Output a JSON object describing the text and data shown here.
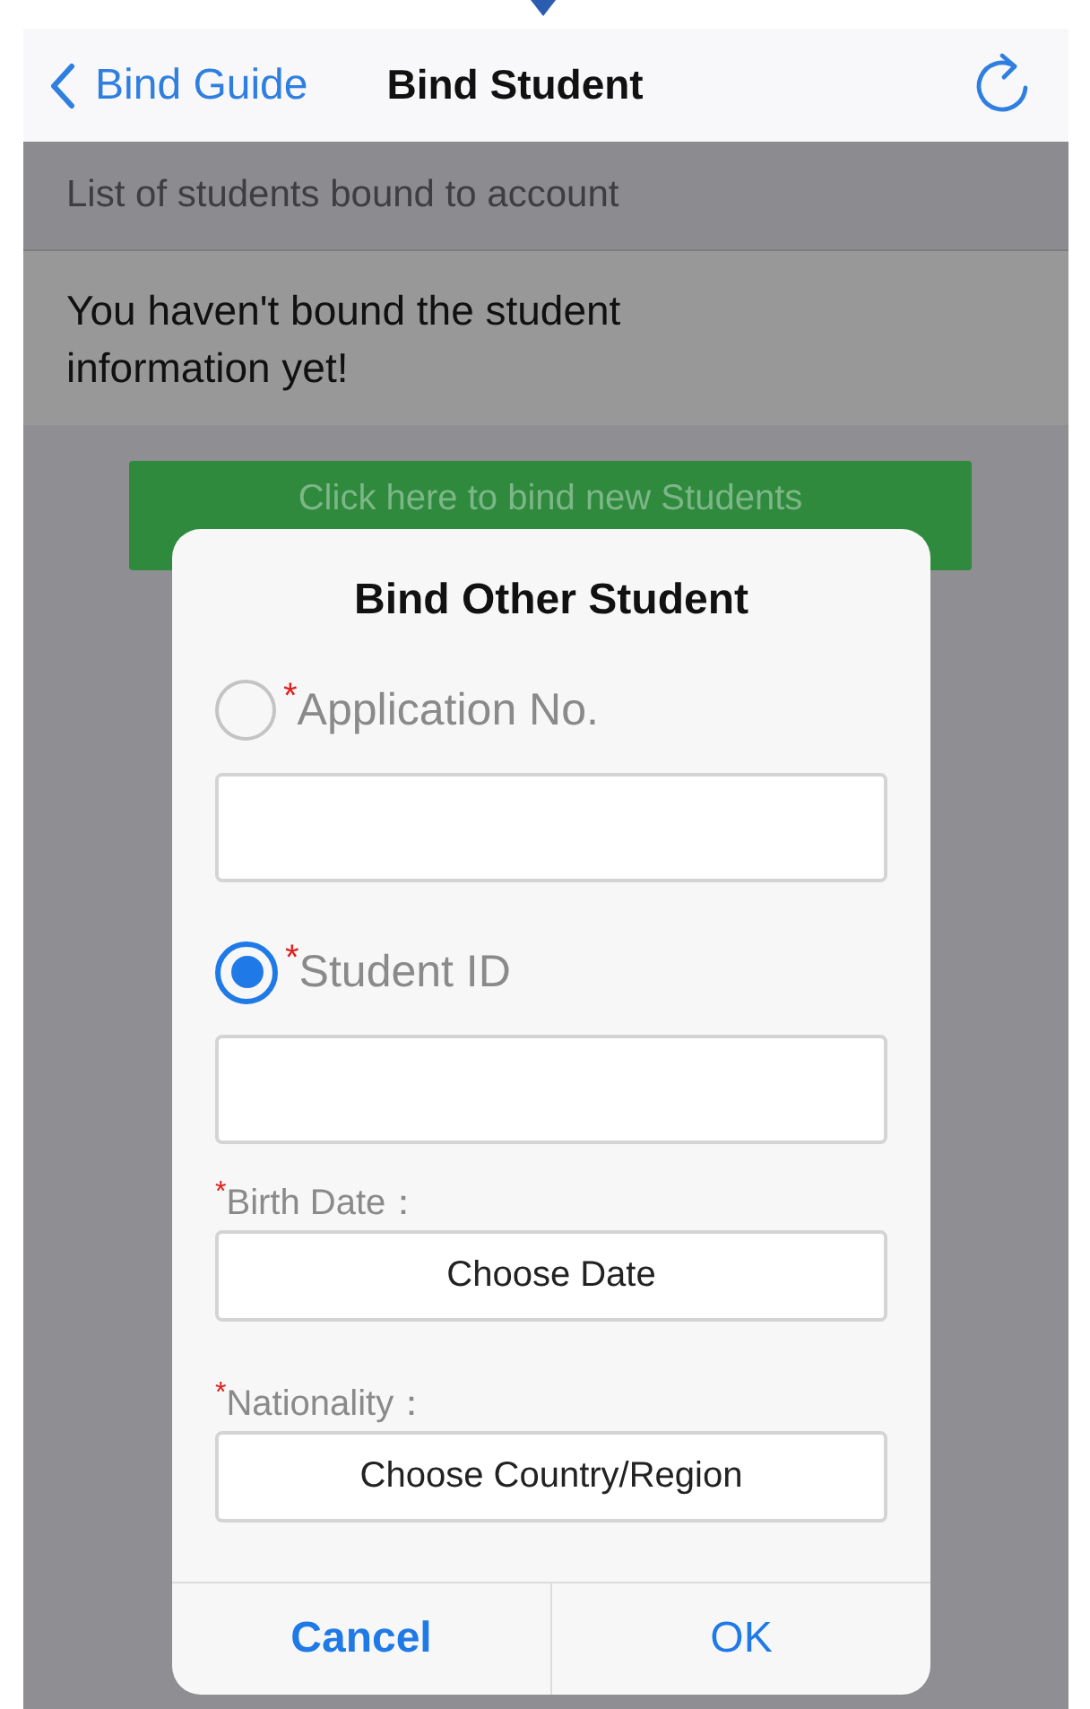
{
  "nav_bar": {
    "back_label": "Bind Guide",
    "title": "Bind Student"
  },
  "section_header": "List of students bound to account",
  "empty_message": "You haven't bound the student information yet!",
  "bind_button": "Click here to bind new Students",
  "dialog": {
    "title": "Bind Other Student",
    "options": [
      {
        "label": "$^{*}$Application No.",
        "selected": false
      },
      {
        "label": "$^{*}$Student ID",
        "selected": true
      }
    ],
    "pickers": [
      {
        "label": "$^{*}$Birth Date：",
        "value": "Choose Date"
      },
      {
        "label": "$^{*}$Nationality：",
        "value": "Choose Country/Region"
      }
    ],
    "buttons": [
      {
        "label": "Cancel",
        "kind": "cancel"
      },
      {
        "label": "OK",
        "kind": "confirm"
      }
    ]
  }
}
